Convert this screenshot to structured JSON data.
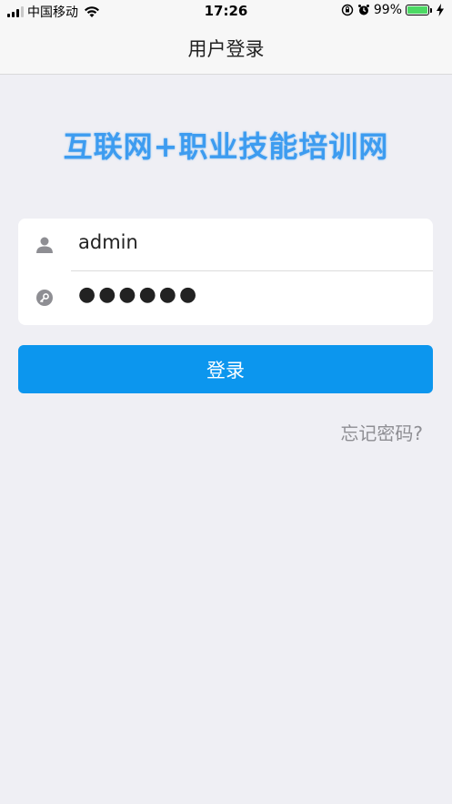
{
  "status_bar": {
    "carrier": "中国移动",
    "time": "17:26",
    "battery_percent": "99%",
    "battery_level": 0.99,
    "signal_bars_active": 3,
    "signal_bars_total": 4
  },
  "nav": {
    "title": "用户登录"
  },
  "brand": {
    "name": "互联网+职业技能培训网"
  },
  "form": {
    "username_value": "admin",
    "password_value": "●●●●●●",
    "user_icon": "user-icon",
    "password_icon": "key-icon"
  },
  "actions": {
    "login_label": "登录",
    "forgot_label": "忘记密码?"
  },
  "colors": {
    "background": "#efeff4",
    "primary": "#0c96ee",
    "brand": "#3d9cf0",
    "muted": "#8e8e93"
  }
}
